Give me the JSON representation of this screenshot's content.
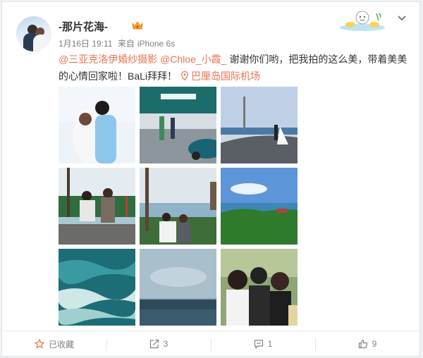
{
  "post": {
    "username": "-那片花海-",
    "date": "1月16日 19:11",
    "source_prefix": "来自",
    "source": "iPhone 6s",
    "mention1": "@三亚克洛伊婚纱摄影",
    "mention2": "@Chloe_小霞_",
    "text1": "谢谢你们哟，把我拍的这么美，带着美美",
    "text2": "的心情回家啦！BaLi拜拜！",
    "location": "巴厘岛国际机场"
  },
  "actions": {
    "favorite": "已收藏",
    "repost": "3",
    "comment": "1",
    "like": "9"
  },
  "colors": {
    "link": "#eb7350",
    "meta": "#808080",
    "text": "#333333"
  },
  "icons": {
    "vip": "vip-crown-icon",
    "menu": "chevron-down-icon",
    "location": "location-pin-icon",
    "favorite": "star-icon",
    "repost": "repost-icon",
    "comment": "comment-icon",
    "like": "thumbs-up-icon"
  }
}
